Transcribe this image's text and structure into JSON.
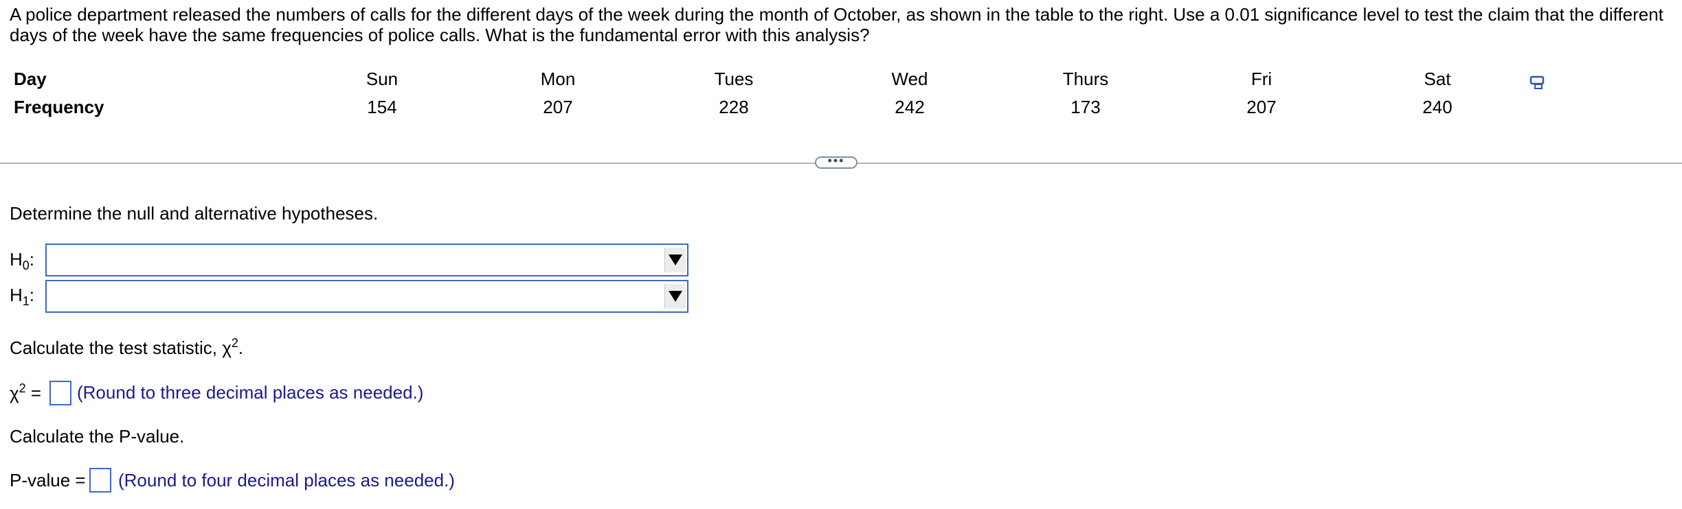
{
  "question": {
    "text": "A police department released the numbers of calls for the different days of the week during the month of October, as shown in the table to the right. Use a 0.01 significance level to test the claim that the different days of the week have the same frequencies of police calls. What is the fundamental error with this analysis?"
  },
  "table": {
    "row1_label": "Day",
    "row2_label": "Frequency",
    "days": [
      "Sun",
      "Mon",
      "Tues",
      "Wed",
      "Thurs",
      "Fri",
      "Sat"
    ],
    "frequencies": [
      "154",
      "207",
      "228",
      "242",
      "173",
      "207",
      "240"
    ]
  },
  "icons": {
    "copy": "copy-data-icon",
    "more": "ellipsis-icon"
  },
  "more_button_label": "•••",
  "hypotheses": {
    "prompt": "Determine the null and alternative hypotheses.",
    "h0_letter": "H",
    "h0_sub": "0",
    "h0_colon": ":",
    "h1_letter": "H",
    "h1_sub": "1",
    "h1_colon": ":",
    "h0_selected": "",
    "h1_selected": ""
  },
  "test_stat": {
    "prompt_text": "Calculate the test statistic, χ",
    "prompt_exp": "2",
    "prompt_end": ".",
    "symbol": "χ",
    "symbol_exp": "2",
    "equals": " =",
    "value": "",
    "hint": "(Round to three decimal places as needed.)"
  },
  "p_value": {
    "prompt": "Calculate the P-value.",
    "label": "P-value =",
    "value": "",
    "hint": "(Round to four decimal places as needed.)"
  },
  "colors": {
    "accent_border": "#3e68c1",
    "hint_text": "#1a1a8c",
    "divider": "#b4b4b4"
  }
}
